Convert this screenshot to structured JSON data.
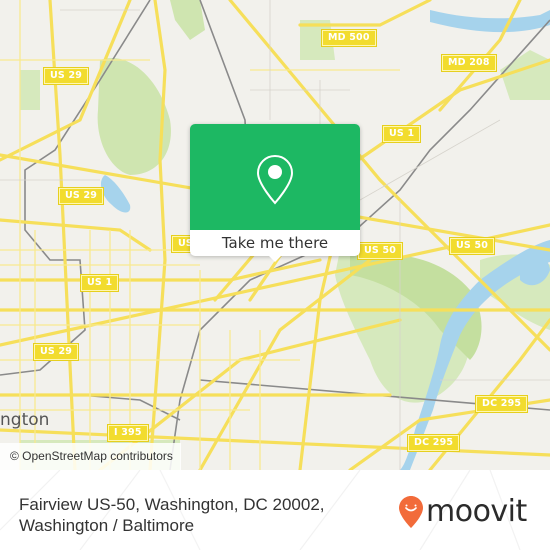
{
  "map": {
    "attribution": "© OpenStreetMap contributors",
    "city_label": "ngton",
    "route_shields": [
      {
        "id": "md500",
        "label": "MD 500"
      },
      {
        "id": "md208",
        "label": "MD 208"
      },
      {
        "id": "us1-ne",
        "label": "US 1"
      },
      {
        "id": "us29-n",
        "label": "US 29"
      },
      {
        "id": "us29-mid",
        "label": "US 29"
      },
      {
        "id": "us-partial",
        "label": "US"
      },
      {
        "id": "us50-a",
        "label": "US 50"
      },
      {
        "id": "us50-b",
        "label": "US 50"
      },
      {
        "id": "us1-w",
        "label": "US 1"
      },
      {
        "id": "us29-sw",
        "label": "US 29"
      },
      {
        "id": "i395",
        "label": "I 395"
      },
      {
        "id": "dc295-a",
        "label": "DC 295"
      },
      {
        "id": "dc295-b",
        "label": "DC 295"
      }
    ],
    "colors": {
      "land": "#f2f1ec",
      "road": "#f6df5a",
      "park": "#cfe5b0",
      "water": "#a6d3ec",
      "rail": "#8a8a8a"
    }
  },
  "popup": {
    "icon": "map-pin-icon",
    "button_label": "Take me there",
    "accent": "#1db863"
  },
  "footer": {
    "address": "Fairview US-50, Washington, DC 20002, Washington / Baltimore",
    "brand": "moovit",
    "brand_color": "#f26b3a"
  }
}
